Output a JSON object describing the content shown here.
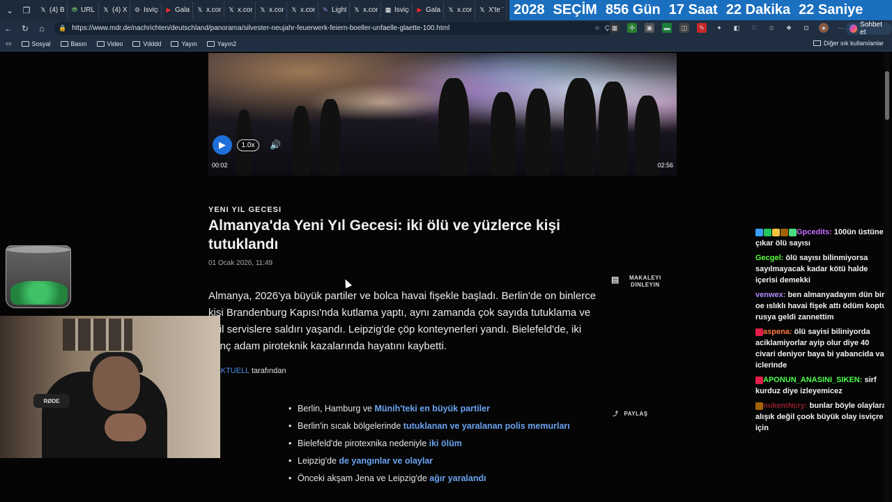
{
  "browser": {
    "tabs": [
      {
        "title": "(4) Bu",
        "icon": "x-icon",
        "color": "#ffffff"
      },
      {
        "title": "URL N",
        "icon": "bucket-icon",
        "color": "#7fd36b"
      },
      {
        "title": "(4) X'te",
        "icon": "x-icon",
        "color": "#ffffff"
      },
      {
        "title": "İsviçre",
        "icon": "gear-icon",
        "color": "#cccccc"
      },
      {
        "title": "Galata",
        "icon": "youtube-icon",
        "color": "#ff2b2b"
      },
      {
        "title": "x.com",
        "icon": "x-icon",
        "color": "#ffffff"
      },
      {
        "title": "x.com",
        "icon": "x-icon",
        "color": "#ffffff"
      },
      {
        "title": "x.com",
        "icon": "x-icon",
        "color": "#ffffff"
      },
      {
        "title": "x.com",
        "icon": "x-icon",
        "color": "#ffffff"
      },
      {
        "title": "LightS",
        "icon": "pen-icon",
        "color": "#a78bfa"
      },
      {
        "title": "x.com",
        "icon": "x-icon",
        "color": "#ffffff"
      },
      {
        "title": "İsviçre",
        "icon": "news-icon",
        "color": "#ffffff"
      },
      {
        "title": "Galata",
        "icon": "youtube-icon",
        "color": "#ff2b2b"
      },
      {
        "title": "x.com",
        "icon": "x-icon",
        "color": "#ffffff"
      },
      {
        "title": "X'te Y",
        "icon": "x-icon",
        "color": "#ffffff"
      }
    ],
    "countdown": [
      "2028",
      "SEÇİM",
      "856 Gün",
      "17 Saat",
      "22 Dakika",
      "22 Saniye"
    ],
    "url": "https://www.mdr.de/nachrichten/deutschland/panorama/silvester-neujahr-feuerwerk-feiern-boeller-unfaelle-glaette-100.html",
    "translate_label": "Çevir",
    "chat_button": "Sohbet et",
    "bookmarks": [
      "Sosyal",
      "Basın",
      "Video",
      "Vdddd",
      "Yayın",
      "Yayın2"
    ],
    "bookmarks_right": "Diğer sık kullanılanlar"
  },
  "video": {
    "speed": "1.0x",
    "current_time": "00:02",
    "duration": "02:56"
  },
  "article": {
    "eyebrow": "YENI YIL GECESI",
    "headline": "Almanya'da Yeni Yıl Gecesi: iki ölü ve yüzlerce kişi tutuklandı",
    "date": "01 Ocak 2026, 11:49",
    "listen_label": "MAKALEYI DINLEYIN",
    "lead": "Almanya, 2026'ya büyük partiler ve bolca havai fişekle başladı. Berlin'de on binlerce kişi Brandenburg Kapısı'nda kutlama yaptı, aynı zamanda çok sayıda tutuklama ve acil servislere saldırı yaşandı. Leipzig'de çöp konteynerleri yandı. Bielefeld'de, iki genç adam piroteknik kazalarında hayatını kaybetti.",
    "byline_source": "R AKTUELL",
    "byline_suffix": "tarafından",
    "share_label": "PAYLAŞ",
    "bullets": [
      {
        "text": "Berlin, Hamburg ve ",
        "link": "Münih'teki en büyük partiler"
      },
      {
        "text": "Berlin'in sıcak bölgelerinde ",
        "link": "tutuklanan ve yaralanan polis memurları"
      },
      {
        "text": "Bielefeld'de pirotexnika nedeniyle ",
        "link": "iki ölüm"
      },
      {
        "text": "Leipzig'de ",
        "link": "de yangınlar ve olaylar"
      },
      {
        "text": "Önceki akşam Jena ve Leipzig'de ",
        "link": "ağır yaralandı"
      }
    ]
  },
  "webcam": {
    "mic_brand": "RØDE"
  },
  "chat": [
    {
      "user": "Gpcedits:",
      "color": "#c86cff",
      "text": "100ün üstüne çıkar ölü sayısı",
      "badges": [
        "#3aa0ff",
        "#22c55e",
        "#f5c542",
        "#a16207",
        "#4ade80"
      ]
    },
    {
      "user": "Gecgel:",
      "color": "#5cff3a",
      "text": "ölü sayısı bilinmiyorsa sayılmayacak kadar kötü halde içerisi demekki",
      "badges": []
    },
    {
      "user": "venwex:",
      "color": "#b58cff",
      "text": "ben almanyadayım dün bir oe ıslıklı havai fişek attı ödüm koptu rusya geldi zannettim",
      "badges": []
    },
    {
      "user": "aspena:",
      "color": "#ff7a3d",
      "text": "ölü sayisi biliniyorda aciklamiyorlar ayip olur diye 40 civari deniyor baya bi yabancida var iclerinde",
      "badges": [
        "#e11d48"
      ]
    },
    {
      "user": "APONUN_ANASINI_SIKEN:",
      "color": "#4dff4d",
      "text": "sirf kurduz diye izleyemicez",
      "badges": [
        "#e11d48"
      ]
    },
    {
      "user": "nukemNcry:",
      "color": "#8b1e2b",
      "text": "bunlar böyle olaylara alışık değil çook büyük olay isviçre için",
      "badges": [
        "#a16207"
      ]
    }
  ]
}
